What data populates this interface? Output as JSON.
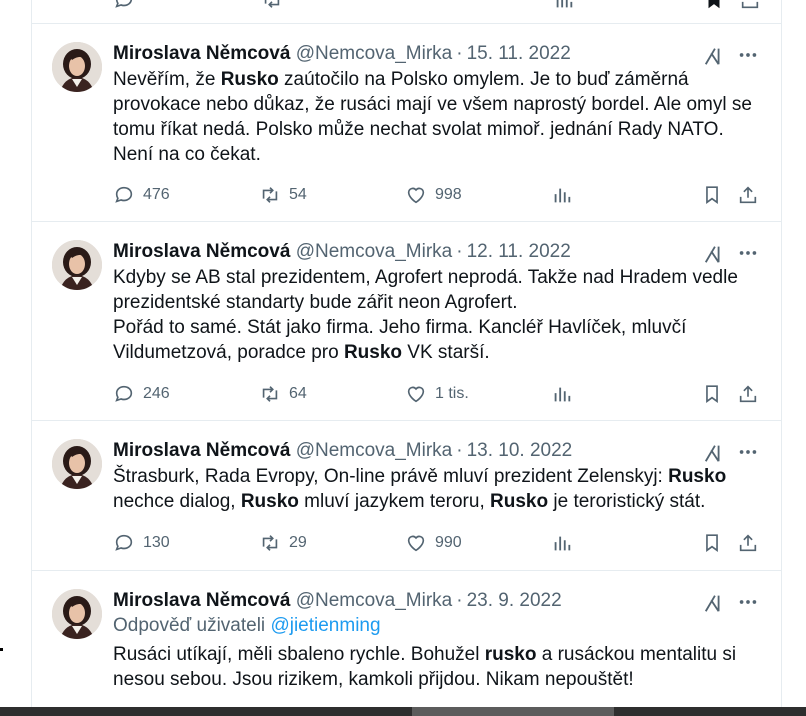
{
  "tweets": [
    {
      "name": "Miroslava Němcová",
      "handle": "@Nemcova_Mirka",
      "date": "15. 11. 2022",
      "text_parts": [
        {
          "t": "Nevěřím, že "
        },
        {
          "t": "Rusko",
          "b": true
        },
        {
          "t": " zaútočilo na Polsko omylem. Je to buď záměrná\nprovokace nebo důkaz, že rusáci mají ve všem naprostý bordel. Ale omyl se\ntomu říkat nedá. Polsko může nechat svolat mimoř. jednání Rady NATO.\nNení na co čekat."
        }
      ],
      "replies": "476",
      "reposts": "54",
      "likes": "998"
    },
    {
      "name": "Miroslava Němcová",
      "handle": "@Nemcova_Mirka",
      "date": "12. 11. 2022",
      "text_parts": [
        {
          "t": "Kdyby se AB stal prezidentem, Agrofert neprodá. Takže nad Hradem vedle\nprezidentské standarty bude zářit neon Agrofert.\nPořád to samé. Stát jako firma. Jeho firma. Kancléř Havlíček, mluvčí\nVildumetzová, poradce pro "
        },
        {
          "t": "Rusko",
          "b": true
        },
        {
          "t": " VK starší."
        }
      ],
      "replies": "246",
      "reposts": "64",
      "likes": "1 tis."
    },
    {
      "name": "Miroslava Němcová",
      "handle": "@Nemcova_Mirka",
      "date": "13. 10. 2022",
      "text_parts": [
        {
          "t": "Štrasburk, Rada Evropy, On-line právě mluví prezident Zelenskyj: "
        },
        {
          "t": "Rusko",
          "b": true
        },
        {
          "t": "\nnechce dialog, "
        },
        {
          "t": "Rusko",
          "b": true
        },
        {
          "t": " mluví jazykem teroru, "
        },
        {
          "t": "Rusko",
          "b": true
        },
        {
          "t": " je teroristický stát."
        }
      ],
      "replies": "130",
      "reposts": "29",
      "likes": "990"
    },
    {
      "name": "Miroslava Němcová",
      "handle": "@Nemcova_Mirka",
      "date": "23. 9. 2022",
      "reply_prefix": "Odpověď uživateli",
      "reply_mention": "@jietienming",
      "text_parts": [
        {
          "t": "Rusáci utíkají, měli sbaleno rychle. Bohužel "
        },
        {
          "t": "rusko",
          "b": true
        },
        {
          "t": " a rusáckou mentalitu si\nnesou sebou. Jsou rizikem, kamkoli přijdou. Nikam nepouštět!"
        }
      ]
    }
  ],
  "icons": {
    "reply": "reply-icon",
    "repost": "repost-icon",
    "like": "heart-icon",
    "views": "views-icon",
    "bookmark": "bookmark-icon",
    "share": "share-icon",
    "grok": "grok-icon",
    "more": "more-icon"
  },
  "colors": {
    "text": "#0f1419",
    "muted": "#536471",
    "link": "#1d9bf0",
    "border": "#e6ecf0"
  }
}
